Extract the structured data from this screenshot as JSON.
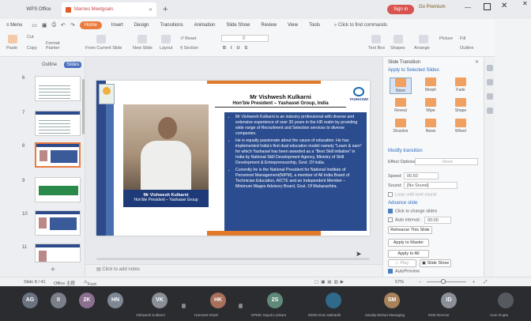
{
  "titlebar": {
    "app_tab": "WPS Office",
    "file_tab": "Marnes Meetgoals",
    "signin": "Sign in",
    "premium": "Go Premium"
  },
  "menu": {
    "menu_label": "Menu",
    "tabs": [
      "Home",
      "Insert",
      "Design",
      "Transitions",
      "Animation",
      "Slide Show",
      "Review",
      "View",
      "Tools"
    ],
    "search": "Click to find commands"
  },
  "ribbon": {
    "paste": "Paste",
    "cut": "Cut",
    "copy": "Copy",
    "format_painter": "Format Painter",
    "from_current_slide": "From Current Slide",
    "new_slide": "New Slide",
    "layout": "Layout",
    "reset": "Reset",
    "section": "Section",
    "font_size": "0",
    "text_box": "Text Box",
    "shapes": "Shapes",
    "arrange": "Arrange",
    "picture": "Picture",
    "fill": "Fill",
    "outline": "Outline"
  },
  "left_pane": {
    "tabs": [
      "Outline",
      "Slides"
    ],
    "slide_numbers": [
      "6",
      "7",
      "8",
      "9",
      "10",
      "11"
    ]
  },
  "slide": {
    "name": "Mr Vishwesh Kulkarni",
    "role": "Hon'ble President – Yashaswi Group, India",
    "logo_text": "YASHASWI",
    "caption_name": "Mr Vishwesh Kulkarni",
    "caption_role": "Hon'ble President – Yashaswi Group",
    "bullets": [
      "Mr Vishwesh Kulkarni is an industry professional with diverse and extensive experience of over 30 years in the HR realm by providing wide range of Recruitment and Selection services to diverse companies.",
      "He is equally passionate about the cause of education. He has implemented India's first dual education model namely \"Learn & earn\" for which Yashaswi has been awarded as a \"Best Skill initiative\" in India by National Skill Development Agency, Ministry of Skill Development & Entrepreneurship, Govt. Of India.",
      "Currently he is the National President for National Institute of Personnel Management(NIPM), a member of All India Board of Technician Education, AICTE and an Independent Member – Minimum Wages Advisory Board, Govt. Of Maharashtra."
    ]
  },
  "notes": "Click to add notes",
  "right_pane": {
    "title": "Slide Transition",
    "apply_selected": "Apply to Selected Slides",
    "transitions": [
      "None",
      "Morph",
      "Fade",
      "Reveal",
      "Wipe",
      "Shape",
      "Dissolve",
      "News",
      "Wheel"
    ],
    "modify_label": "Modify transition",
    "effect_options_label": "Effect Options:",
    "effect_options_value": "None",
    "speed_label": "Speed:",
    "speed_value": "00.50",
    "sound_label": "Sound:",
    "sound_value": "[No Sound]",
    "loop_label": "Loop until next sound",
    "advance_label": "Advance slide",
    "on_click_label": "Click to change slides",
    "auto_label": "Auto interval:",
    "auto_value": "00:00",
    "rehearse_btn": "Rehearse This Slide",
    "apply_master_btn": "Apply to Master",
    "apply_all_btn": "Apply to All",
    "play_btn": "Play",
    "slide_show_btn": "Slide Show",
    "autopreview_label": "AutoPreview"
  },
  "status": {
    "slide_info": "Slide 8 / 41",
    "theme": "Office 主题",
    "font_missing": "Font Missing",
    "zoom": "57%"
  },
  "participants": [
    {
      "initials": "AG",
      "color": "#6b7280",
      "name": ""
    },
    {
      "initials": "II",
      "color": "#7a7f8a",
      "name": ""
    },
    {
      "initials": "2K",
      "color": "#8a6f8f",
      "name": ""
    },
    {
      "initials": "HN",
      "color": "#7f8794",
      "name": ""
    },
    {
      "initials": "VK",
      "color": "#8a8f98",
      "name": "Vishwesh Kulkarni"
    },
    {
      "initials": "HK",
      "color": "#a86f5a",
      "name": "Harmeet Khatri"
    },
    {
      "initials": "2S",
      "color": "#5f8a7a",
      "name": "KPMG Sayali Lonkare"
    },
    {
      "initials": "",
      "color": "#2f6a8a",
      "name": "MSW Kiran Mahadik"
    },
    {
      "initials": "SM",
      "color": "#a8825a",
      "name": "Sandip Mohan Managing"
    },
    {
      "initials": "ID",
      "color": "#8a8f98",
      "name": "KMS Director"
    },
    {
      "initials": "",
      "color": "#555a60",
      "name": "Arun Gupta"
    }
  ]
}
